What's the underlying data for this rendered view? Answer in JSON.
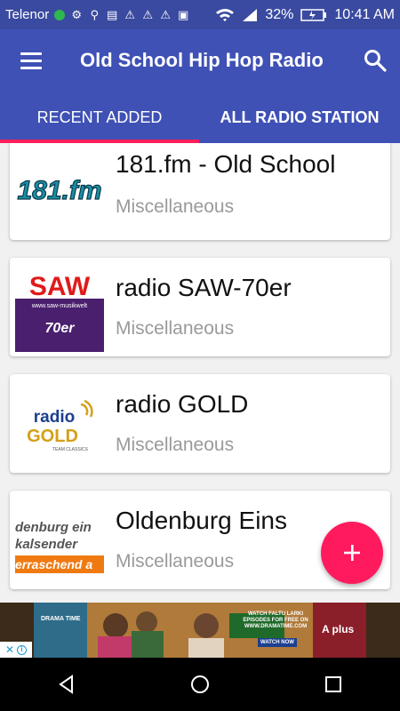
{
  "status_bar": {
    "carrier": "Telenor",
    "battery": "32%",
    "time": "10:41 AM"
  },
  "app_bar": {
    "title": "Old School Hip Hop Radio"
  },
  "tabs": [
    {
      "label": "RECENT ADDED",
      "active": true
    },
    {
      "label": "ALL RADIO STATION",
      "active": false
    }
  ],
  "stations": [
    {
      "name": "181.fm - Old School",
      "category": "Miscellaneous",
      "logo_text": "181.fm"
    },
    {
      "name": "radio SAW-70er",
      "category": "Miscellaneous",
      "logo_text": "SAW",
      "logo_sub": "70er",
      "logo_url": "www.saw-musikwelt"
    },
    {
      "name": "radio GOLD",
      "category": "Miscellaneous",
      "logo_text": "radio",
      "logo_gold": "GOLD",
      "logo_tag": "TEAM CLASSICS"
    },
    {
      "name": "Oldenburg Eins",
      "category": "Miscellaneous",
      "logo_line1": "denburg ein",
      "logo_line2": "kalsender",
      "logo_line3": "erraschend a"
    }
  ],
  "ad": {
    "brand_left": "DRAMA TIME",
    "headline": "WATCH FALTU LARKI EPISODES FOR FREE ON WWW.DRAMATIME.COM",
    "cta": "WATCH NOW",
    "brand_right": "A plus"
  },
  "colors": {
    "primary": "#3f51b5",
    "accent": "#ff1a5e"
  }
}
